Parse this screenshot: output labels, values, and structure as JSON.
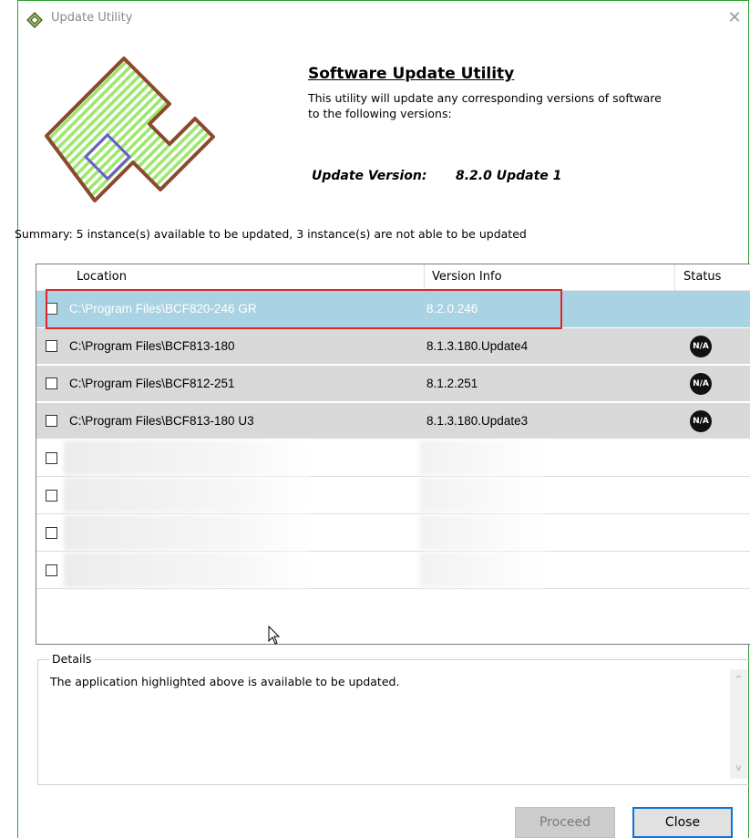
{
  "window": {
    "title": "Update Utility",
    "close_glyph": "✕",
    "icon": "app-logo-icon"
  },
  "header": {
    "heading": "Software Update Utility",
    "description": "This utility will update any corresponding versions of software to the following versions:",
    "update_version_label": "Update Version:",
    "update_version_value": "8.2.0 Update 1"
  },
  "summary": "Summary:  5 instance(s) available to be updated, 3 instance(s) are not able to be updated",
  "table": {
    "columns": [
      "Location",
      "Version Info",
      "Status"
    ],
    "rows": [
      {
        "location": "C:\\Program Files\\BCF820-246 GR",
        "version": "8.2.0.246",
        "status": ""
      },
      {
        "location": "C:\\Program Files\\BCF813-180",
        "version": "8.1.3.180.Update4",
        "status": "N/A"
      },
      {
        "location": "C:\\Program Files\\BCF812-251",
        "version": "8.1.2.251",
        "status": "N/A"
      },
      {
        "location": "C:\\Program Files\\BCF813-180 U3",
        "version": "8.1.3.180.Update3",
        "status": "N/A"
      }
    ],
    "redacted_rows": 4
  },
  "details": {
    "label": "Details",
    "text": "The application highlighted above is available to be updated.",
    "scroll_up": "^",
    "scroll_down": "v"
  },
  "buttons": {
    "proceed": "Proceed",
    "close": "Close"
  },
  "colors": {
    "selected_row": "#a9d3e3",
    "unavailable_row": "#d9d9d9",
    "highlight_box": "#e0242a",
    "window_border": "#2f9e2f",
    "logo_green": "#7ed957",
    "logo_brown": "#8b4a2e"
  }
}
